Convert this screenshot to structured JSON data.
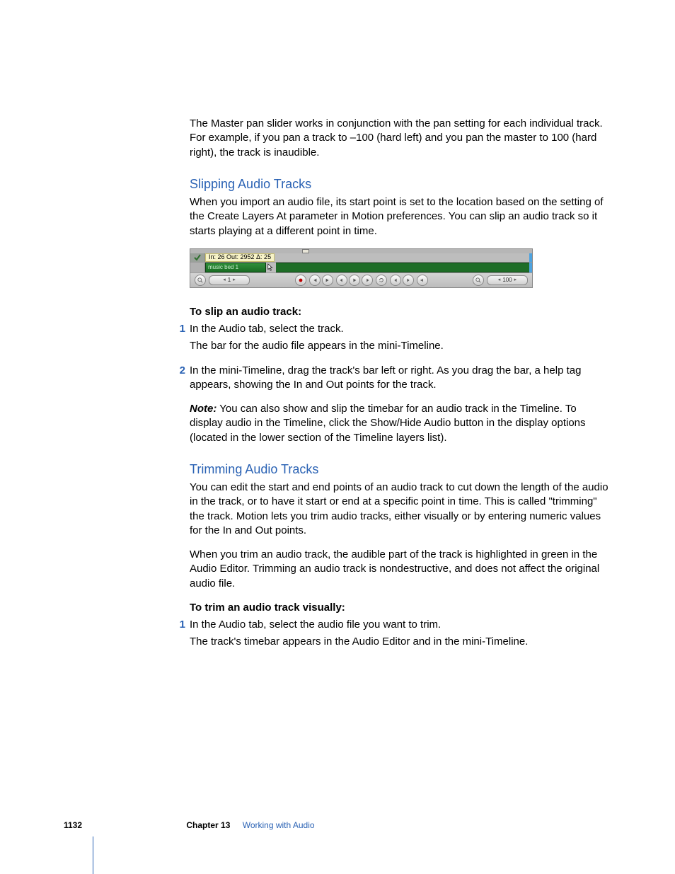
{
  "intro_para": "The Master pan slider works in conjunction with the pan setting for each individual track. For example, if you pan a track to –100 (hard left) and you pan the master to 100 (hard right), the track is inaudible.",
  "section1": {
    "heading": "Slipping Audio Tracks",
    "para": "When you import an audio file, its start point is set to the location based on the setting of the Create Layers At parameter in Motion preferences. You can slip an audio track so it starts playing at a different point in time.",
    "howto_label": "To slip an audio track:",
    "steps": [
      {
        "num": "1",
        "text": "In the Audio tab, select the track.",
        "note": "The bar for the audio file appears in the mini-Timeline."
      },
      {
        "num": "2",
        "text": "In the mini-Timeline, drag the track's bar left or right. As you drag the bar, a help tag appears, showing the In and Out points for the track.",
        "note": ""
      }
    ],
    "note_label": "Note:",
    "note_text": "  You can also show and slip the timebar for an audio track in the Timeline. To display audio in the Timeline, click the Show/Hide Audio button in the display options (located in the lower section of the Timeline layers list)."
  },
  "section2": {
    "heading": "Trimming Audio Tracks",
    "para1": "You can edit the start and end points of an audio track to cut down the length of the audio in the track, or to have it start or end at a specific point in time. This is called \"trimming\" the track. Motion lets you trim audio tracks, either visually or by entering numeric values for the In and Out points.",
    "para2": "When you trim an audio track, the audible part of the track is highlighted in green in the Audio Editor. Trimming an audio track is nondestructive, and does not affect the original audio file.",
    "howto_label": "To trim an audio track visually:",
    "steps": [
      {
        "num": "1",
        "text": "In the Audio tab, select the audio file you want to trim.",
        "note": "The track's timebar appears in the Audio Editor and in the mini-Timeline."
      }
    ]
  },
  "figure": {
    "help_tag": "In: 26 Out: 2952 Δ: 25",
    "clip_name": "music bed 1",
    "left_value": "1",
    "right_value": "100"
  },
  "footer": {
    "page": "1132",
    "chapter_label": "Chapter 13",
    "chapter_title": "Working with Audio"
  }
}
